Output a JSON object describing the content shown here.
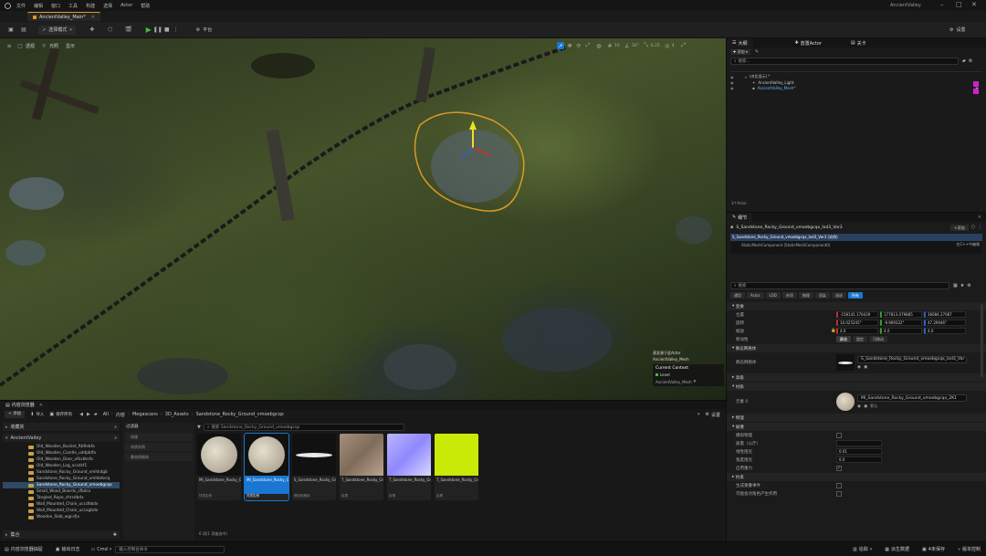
{
  "titlebar": {
    "menu": [
      "文件",
      "编辑",
      "窗口",
      "工具",
      "构建",
      "选择",
      "Actor",
      "帮助"
    ],
    "project": "AncientValley"
  },
  "tabs": {
    "level_tab": "AncientValley_Main*"
  },
  "toolbar": {
    "mode": "选择模式",
    "platform": "平台",
    "settings": "设置"
  },
  "viewport": {
    "perspective": "透视",
    "lit": "光照",
    "show": "显示",
    "overlay": {
      "hint": "蒸发源于此Actor",
      "actor": "AncientValley_Mesh",
      "current_context": "Current Context",
      "level": "Level",
      "level_name": "AncientValley_Mesh"
    }
  },
  "outliner": {
    "tabs": [
      "大纲",
      "放置Actor",
      "关卡"
    ],
    "search_placeholder": "搜索...",
    "items": [
      "(对比显示) *",
      "AncientValley_Light",
      "AncientValley_Mesh*"
    ],
    "count": "3个Actor"
  },
  "details": {
    "tab": "细节",
    "actor_name": "S_Sandstone_Rocky_Ground_vmoebgcqx_lod3_Var3",
    "add_button": "+添加",
    "component_root": "S_Sandstone_Rocky_Ground_vmoebgcqx_lod3_Var3 (实例)",
    "component_child": "StaticMeshComponent (StaticMeshComponent0)",
    "component_edit": "在C++中编辑",
    "search_placeholder": "搜索",
    "filters": [
      "通用",
      "Actor",
      "LOD",
      "杂项",
      "物理",
      "渲染",
      "流送",
      "所有"
    ],
    "active_filter": "所有",
    "sections": {
      "transform": "变换",
      "static_mesh": "静态网格体",
      "advanced": "高级",
      "materials": "材质",
      "physics": "物理",
      "collision": "碰撞"
    },
    "transform": {
      "location_label": "位置",
      "location": [
        "-158141.176439",
        "177813.079885",
        "36684.27087"
      ],
      "rotation_label": "旋转",
      "rotation": [
        "10.025245°",
        "-9.969322°",
        "47.29046°"
      ],
      "scale_label": "缩放",
      "scale": [
        "4.0",
        "4.0",
        "4.0"
      ],
      "mobility_label": "移动性",
      "mobility": [
        "静态",
        "固定",
        "可移动"
      ]
    },
    "static_mesh_label": "静态网格体",
    "static_mesh_value": "S_Sandstone_Rocky_Ground_vmoebgcqx_lod3_Var",
    "material_label": "元素 0",
    "material_value": "MI_Sandstone_Rocky_Ground_vmoebgcqx_2K1",
    "material_sub": "默认",
    "physics_rows": [
      "模拟物理",
      "质量（公斤）",
      "线性阻尼",
      "角度阻尼",
      "启用重力"
    ],
    "physics_values": [
      "",
      "",
      "0.01",
      "0.0",
      ""
    ],
    "more_rows": [
      "约束",
      "生成重叠事件",
      "可能会对角色产生作用"
    ]
  },
  "content": {
    "tab": "内容浏览器",
    "add": "+ 添加",
    "import": "导入",
    "save_all": "保存所有",
    "breadcrumb": [
      "All",
      "内容",
      "Megascans",
      "3D_Assets",
      "Sandstone_Rocky_Ground_vmoebgcqx"
    ],
    "settings": "设置",
    "favorites": "收藏夹",
    "root": "AncientValley",
    "folders": [
      "Old_Wooden_Bucket_Rbfiebfa",
      "Old_Wooden_Candle_uddpblfa",
      "Old_Wooden_Door_ufkvbtvfa",
      "Old_Wooden_Log_xcsdcf1",
      "Sandstone_Rocky_Ground_vmhkdgb",
      "Sandstone_Rocky_Ground_vmhbdvcq",
      "Sandstone_Rocky_Ground_vmoebgcqx",
      "Small_Wood_Boards_sfbdcx",
      "Tangled_Rope_vhrsdbdx",
      "Wall_Mounted_Chain_uccdhbdx",
      "Wall_Mounted_Chain_uccxgbdx",
      "Wooden_Slab_wgcsfjx"
    ],
    "collections": "集合",
    "filters_header": "过滤器",
    "filter_items": [
      "纹理",
      "材质实例",
      "静态网格体"
    ],
    "search_placeholder": "搜索 Sandstone_Rocky_Ground_vmoebgcqx",
    "assets": [
      {
        "name": "MI_Sandstone_Rocky_Ground_vmoebgcqx_2K",
        "type": "材质实例"
      },
      {
        "name": "MI_Sandstone_Rocky_Ground_vmoebgcqx_2K1",
        "type": "材质实例"
      },
      {
        "name": "S_Sandstone_Rocky_Ground_vmoebgcqx_lod3...",
        "type": "静态网格体"
      },
      {
        "name": "T_Sandstone_Rocky_Ground_vmoebgcqx_2K_D",
        "type": "纹理"
      },
      {
        "name": "T_Sandstone_Rocky_Ground_vmoebgcqx_2K_N",
        "type": "纹理"
      },
      {
        "name": "T_Sandstone_Rocky_Ground_vmoebgcqx_2K_ORM",
        "type": "纹理"
      }
    ],
    "count": "6 项(1 项被选中)"
  },
  "statusbar": {
    "content_drawer": "内容浏览器抽屉",
    "output_log": "输出日志",
    "cmd": "Cmd",
    "console_placeholder": "输入控制台命令",
    "trace": "追踪",
    "derived_data": "派生数据",
    "unsaved": "4未保存",
    "source_control": "版本控制"
  },
  "colors": {
    "accent_blue": "#1976d2",
    "selection_gold": "#d89a25",
    "play_green": "#3dbb3d",
    "grid_yellow": "#c8ea06"
  }
}
